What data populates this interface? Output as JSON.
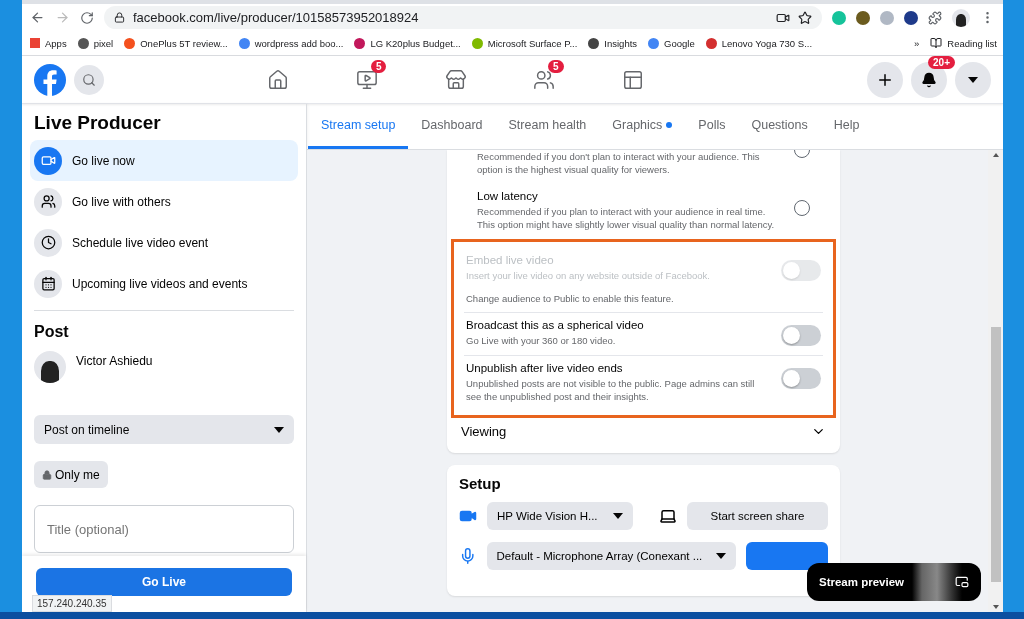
{
  "browser": {
    "url": "facebook.com/live/producer/10158573952018924",
    "bookmarks": [
      {
        "label": "Apps",
        "color": "#ea4335"
      },
      {
        "label": "pixel",
        "color": "#555555"
      },
      {
        "label": "OnePlus 5T review...",
        "color": "#f4511e"
      },
      {
        "label": "wordpress add boo...",
        "color": "#4285f4"
      },
      {
        "label": "LG K20plus Budget...",
        "color": "#c2185b"
      },
      {
        "label": "Microsoft Surface P...",
        "color": "#7fba00"
      },
      {
        "label": "Insights",
        "color": "#444444"
      },
      {
        "label": "Google",
        "color": "#4285f4"
      },
      {
        "label": "Lenovo Yoga 730 S...",
        "color": "#d32f2f"
      }
    ],
    "more": "»",
    "reading_list": "Reading list",
    "status": "157.240.240.35"
  },
  "header": {
    "nav": [
      {
        "kind": "home"
      },
      {
        "kind": "watch",
        "badge": "5"
      },
      {
        "kind": "marketplace"
      },
      {
        "kind": "groups",
        "badge": "5"
      },
      {
        "kind": "gaming"
      }
    ],
    "notifications": "20+"
  },
  "sidebar": {
    "title": "Live Producer",
    "items": [
      {
        "kind": "video",
        "label": "Go live now",
        "selected": true
      },
      {
        "kind": "people",
        "label": "Go live with others",
        "selected": false
      },
      {
        "kind": "clock",
        "label": "Schedule live video event",
        "selected": false
      },
      {
        "kind": "calendar",
        "label": "Upcoming live videos and events",
        "selected": false
      }
    ],
    "post_heading": "Post",
    "user": "Victor Ashiedu",
    "destination": "Post on timeline",
    "audience": "Only me",
    "title_placeholder": "Title (optional)",
    "go_live": "Go Live"
  },
  "tabs": [
    {
      "label": "Stream setup",
      "selected": true,
      "dot": false
    },
    {
      "label": "Dashboard",
      "selected": false,
      "dot": false
    },
    {
      "label": "Stream health",
      "selected": false,
      "dot": false
    },
    {
      "label": "Graphics",
      "selected": false,
      "dot": true
    },
    {
      "label": "Polls",
      "selected": false,
      "dot": false
    },
    {
      "label": "Questions",
      "selected": false,
      "dot": false
    },
    {
      "label": "Help",
      "selected": false,
      "dot": false
    }
  ],
  "latency": [
    {
      "description": "Recommended if you don't plan to interact with your audience. This option is the highest visual quality for viewers.",
      "selected": false
    },
    {
      "title": "Low latency",
      "description": "Recommended if you plan to interact with your audience in real time. This option might have slightly lower visual quality than normal latency.",
      "selected": false
    }
  ],
  "settings": [
    {
      "title": "Embed live video",
      "description": "Insert your live video on any website outside of Facebook.",
      "note": "Change audience to Public to enable this feature.",
      "on": false,
      "disabled": true
    },
    {
      "title": "Broadcast this as a spherical video",
      "description": "Go Live with your 360 or 180 video.",
      "on": false,
      "disabled": false
    },
    {
      "title": "Unpublish after live video ends",
      "description": "Unpublished posts are not visible to the public. Page admins can still see the unpublished post and their insights.",
      "on": false,
      "disabled": false
    }
  ],
  "viewing": {
    "title": "Viewing",
    "expanded": false
  },
  "setup": {
    "title": "Setup",
    "camera": "HP Wide Vision H...",
    "screen_share": "Start screen share",
    "microphone": "Default - Microphone Array (Conexant ..."
  },
  "preview": {
    "label": "Stream preview"
  }
}
